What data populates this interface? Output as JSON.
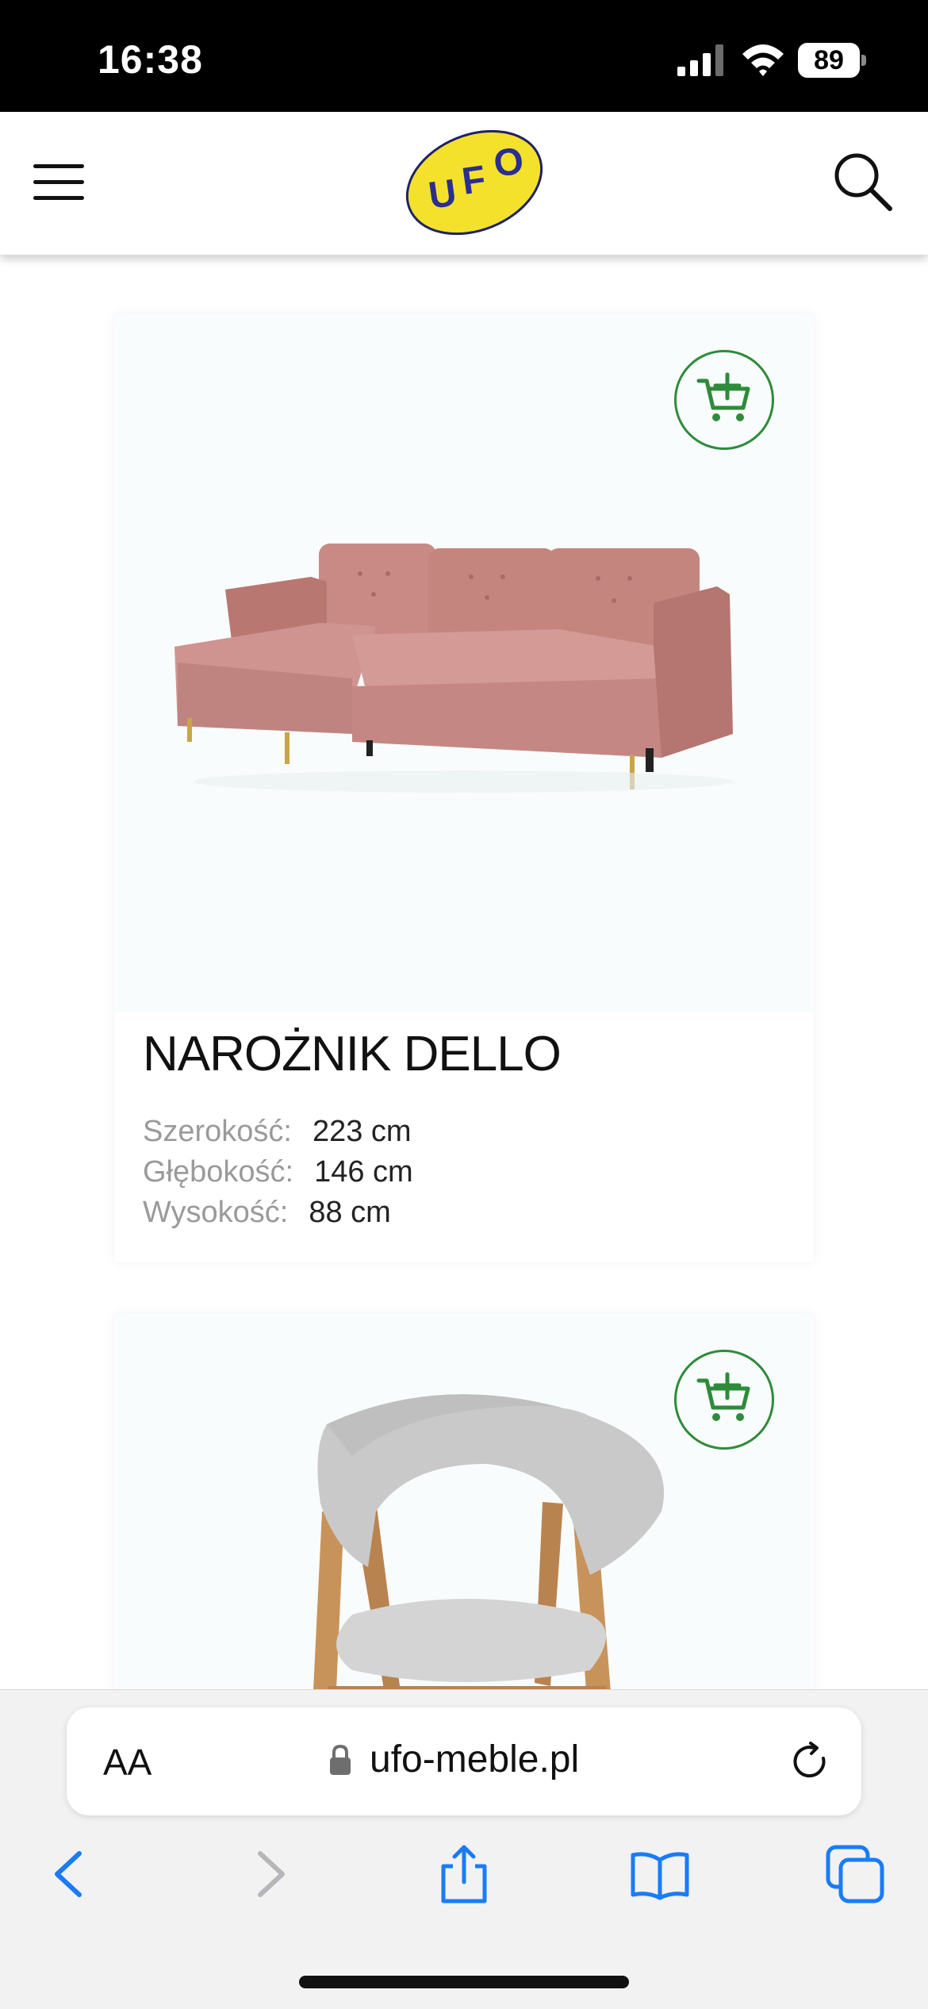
{
  "status_bar": {
    "time": "16:38",
    "battery": "89",
    "icons": [
      "signal-icon",
      "wifi-icon",
      "battery-icon"
    ]
  },
  "header": {
    "menu_icon": "hamburger-menu-icon",
    "logo_text": "UFO",
    "search_icon": "search-icon",
    "colors": {
      "logo_yellow": "#f4e12c",
      "logo_blue": "#2a2f8f"
    }
  },
  "products": [
    {
      "name": "NAROŻNIK DELLO",
      "cart_icon": "add-to-cart-icon",
      "specs": [
        {
          "label": "Szerokość:",
          "value": "223 cm"
        },
        {
          "label": "Głębokość:",
          "value": "146 cm"
        },
        {
          "label": "Wysokość:",
          "value": "88 cm"
        }
      ],
      "image": "pink corner sofa"
    },
    {
      "cart_icon": "add-to-cart-icon",
      "image": "grey armchair with wooden legs"
    }
  ],
  "browser": {
    "text_size_label": "AA",
    "url": "ufo-meble.pl",
    "icons": [
      "lock-icon",
      "reload-icon",
      "back-icon",
      "forward-icon",
      "share-icon",
      "bookmarks-icon",
      "tabs-icon"
    ],
    "accent": "#1a7cf5"
  },
  "accent_green": "#2e8b3a"
}
